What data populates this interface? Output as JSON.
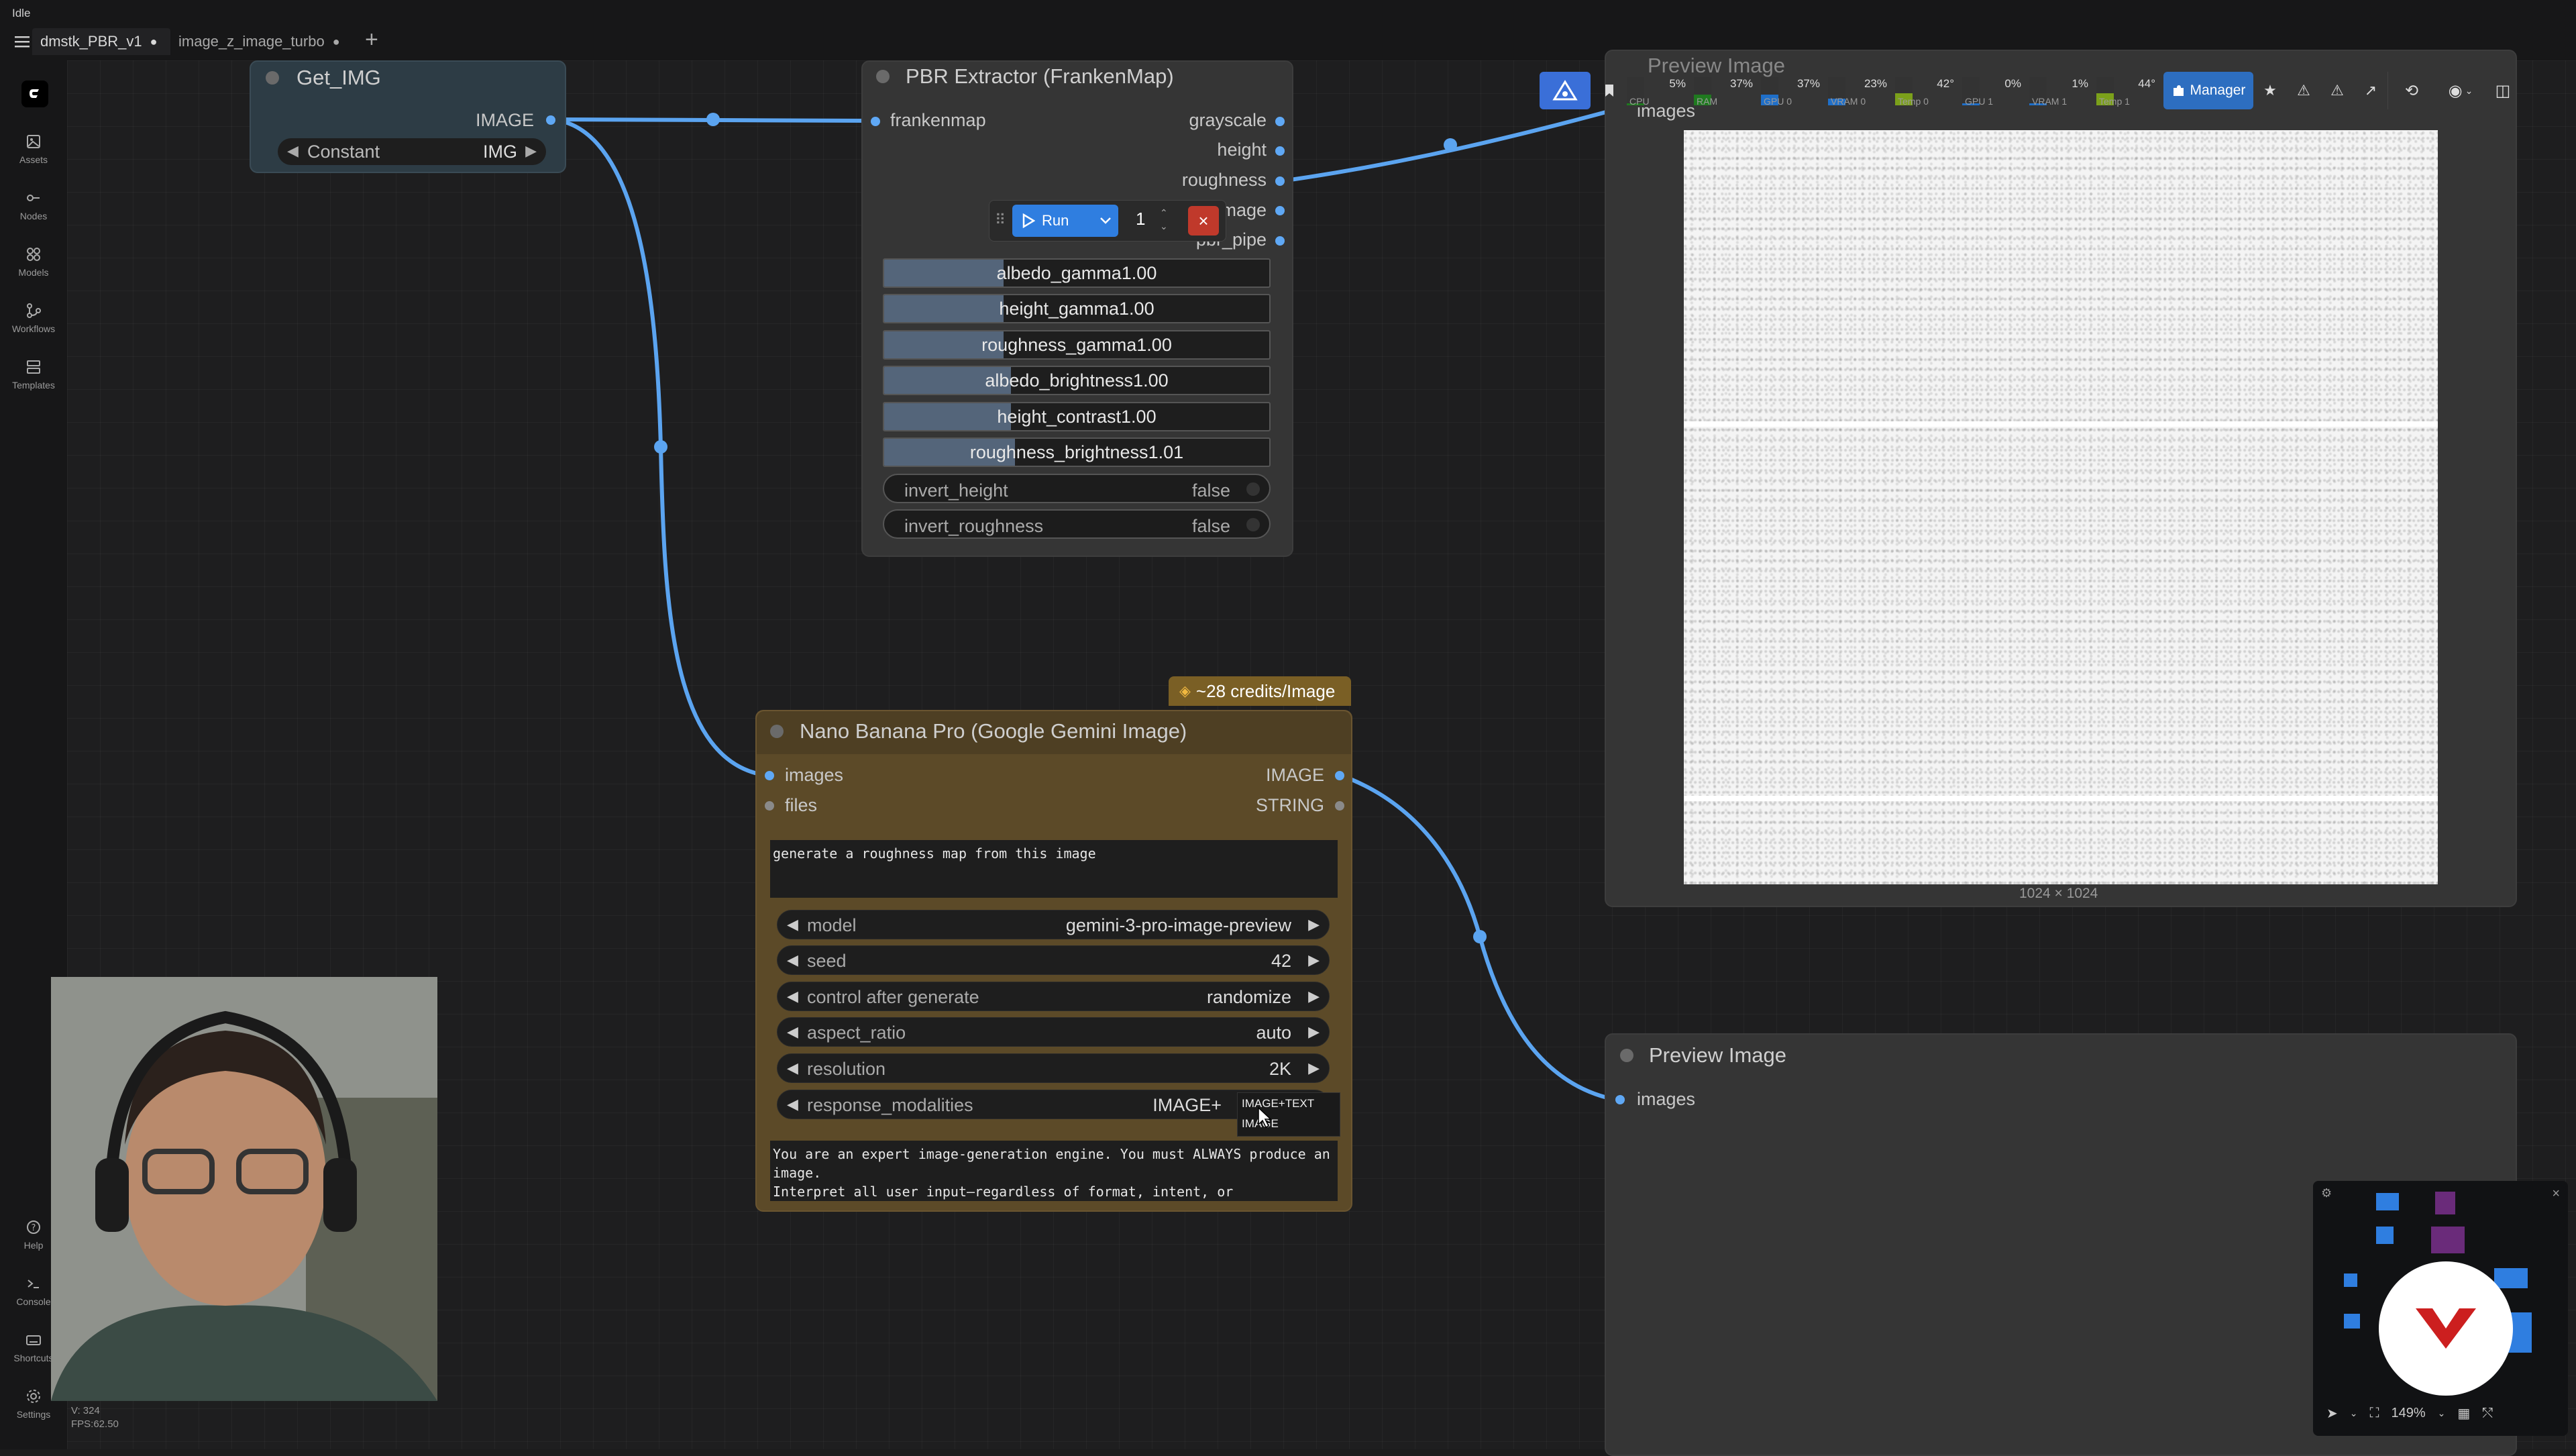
{
  "status": "Idle",
  "tabs": [
    {
      "label": "dmstk_PBR_v1",
      "modified": "●"
    },
    {
      "label": "image_z_image_turbo",
      "modified": "●"
    }
  ],
  "new_tab": "+",
  "sidebar": {
    "items": [
      {
        "label": "Assets"
      },
      {
        "label": "Nodes"
      },
      {
        "label": "Models"
      },
      {
        "label": "Workflows"
      },
      {
        "label": "Templates"
      }
    ],
    "bottom": [
      {
        "label": "Help"
      },
      {
        "label": "Console"
      },
      {
        "label": "Shortcuts"
      },
      {
        "label": "Settings"
      }
    ],
    "stats": {
      "vertices": "V: 324",
      "fps": "FPS:62.50"
    }
  },
  "toolbar": {
    "monitors": [
      {
        "name": "CPU",
        "pct": "5%",
        "level": 0.05,
        "color": "#1f7a1f"
      },
      {
        "name": "RAM",
        "pct": "37%",
        "level": 0.37,
        "color": "#1f7a1f"
      },
      {
        "name": "GPU 0",
        "pct": "37%",
        "level": 0.37,
        "color": "#1f6fc9"
      },
      {
        "name": "VRAM 0",
        "pct": "23%",
        "level": 0.23,
        "color": "#1f6fc9"
      },
      {
        "name": "Temp 0",
        "pct": "42°",
        "level": 0.42,
        "color": "#7ba01a"
      },
      {
        "name": "GPU 1",
        "pct": "0%",
        "level": 0.0,
        "color": "#1f6fc9"
      },
      {
        "name": "VRAM 1",
        "pct": "1%",
        "level": 0.01,
        "color": "#1f6fc9"
      },
      {
        "name": "Temp 1",
        "pct": "44°",
        "level": 0.44,
        "color": "#7ba01a"
      }
    ],
    "manager_label": "Manager"
  },
  "nodes": {
    "get_img": {
      "title": "Get_IMG",
      "output": "IMAGE",
      "widget_label": "Constant",
      "widget_value": "IMG"
    },
    "pbr": {
      "title": "PBR Extractor (FrankenMap)",
      "input": "frankenmap",
      "outputs": [
        "grayscale",
        "height",
        "roughness",
        "image",
        "pbr_pipe"
      ],
      "sliders": [
        {
          "name": "albedo_gamma",
          "value": "1.00",
          "level": 0.31
        },
        {
          "name": "height_gamma",
          "value": "1.00",
          "level": 0.31
        },
        {
          "name": "roughness_gamma",
          "value": "1.00",
          "level": 0.31
        },
        {
          "name": "albedo_brightness",
          "value": "1.00",
          "level": 0.33
        },
        {
          "name": "height_contrast",
          "value": "1.00",
          "level": 0.33
        },
        {
          "name": "roughness_brightness",
          "value": "1.01",
          "level": 0.34
        }
      ],
      "toggles": [
        {
          "name": "invert_height",
          "value": "false"
        },
        {
          "name": "invert_roughness",
          "value": "false"
        }
      ]
    },
    "run": {
      "label": "Run",
      "count": "1",
      "cancel": "×"
    },
    "nano": {
      "badge": "~28 credits/Image",
      "title": "Nano Banana Pro (Google Gemini Image)",
      "inputs": [
        "images",
        "files"
      ],
      "outputs": [
        "IMAGE",
        "STRING"
      ],
      "prompt": "generate a roughness map from this image",
      "widgets": [
        {
          "name": "model",
          "value": "gemini-3-pro-image-preview"
        },
        {
          "name": "seed",
          "value": "42"
        },
        {
          "name": "control after generate",
          "value": "randomize"
        },
        {
          "name": "aspect_ratio",
          "value": "auto"
        },
        {
          "name": "resolution",
          "value": "2K"
        },
        {
          "name": "response_modalities",
          "value": "IMAGE+"
        }
      ],
      "dropdown": [
        "IMAGE+TEXT",
        "IMAGE"
      ],
      "system_prompt": "You are an expert image-generation engine. You must ALWAYS produce an image.\nInterpret all user input—regardless of format, intent, or"
    },
    "preview_top": {
      "title": "Preview Image",
      "input": "images",
      "size": "1024 × 1024"
    },
    "preview_bottom": {
      "title": "Preview Image",
      "input": "images"
    }
  },
  "zoom": "149%"
}
